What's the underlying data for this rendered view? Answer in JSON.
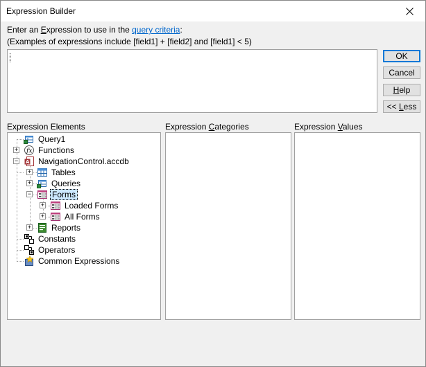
{
  "window": {
    "title": "Expression Builder"
  },
  "prompt": {
    "line1_prefix": "Enter an ",
    "line1_accel": "E",
    "line1_mid": "xpression to use in the ",
    "link": "query criteria",
    "line1_suffix": ":",
    "line2": "(Examples of expressions include [field1] + [field2] and [field1] < 5)"
  },
  "expression_value": "",
  "buttons": {
    "ok": "OK",
    "cancel": "Cancel",
    "help_accel": "H",
    "help_rest": "elp",
    "less": "<< Less",
    "less_accel": "L",
    "less_prefix": "<< ",
    "less_rest": "ess"
  },
  "columns": {
    "elements": "Expression Elements",
    "categories_pre": "Expression ",
    "categories_accel": "C",
    "categories_rest": "ategories",
    "values_pre": "Expression ",
    "values_accel": "V",
    "values_rest": "alues"
  },
  "tree": {
    "query1": "Query1",
    "functions": "Functions",
    "database": "NavigationControl.accdb",
    "tables": "Tables",
    "queries": "Queries",
    "forms": "Forms",
    "loaded_forms": "Loaded Forms",
    "all_forms": "All Forms",
    "reports": "Reports",
    "constants": "Constants",
    "operators": "Operators",
    "common": "Common Expressions"
  },
  "colors": {
    "accent": "#0078d7",
    "link": "#0066cc",
    "selection": "#cce8ff"
  }
}
